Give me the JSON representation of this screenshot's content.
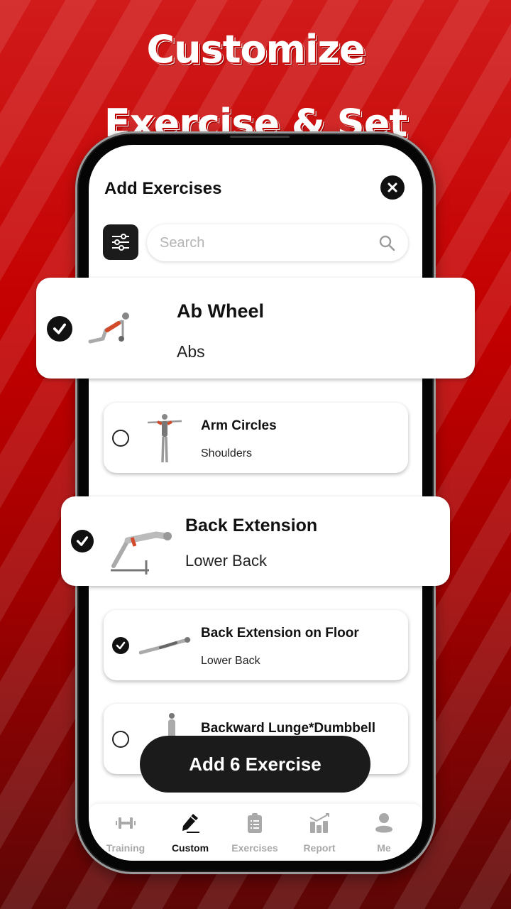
{
  "promo": {
    "line1": "Customize",
    "line2": "Exercise & Set"
  },
  "sheet": {
    "title": "Add Exercises",
    "close_icon": "close-icon",
    "filter_icon": "sliders-icon"
  },
  "search": {
    "placeholder": "Search",
    "value": "",
    "icon": "search-icon"
  },
  "exercises": [
    {
      "name": "Ab Wheel",
      "muscle": "Abs",
      "selected": true,
      "highlighted": true
    },
    {
      "name": "Arm Circles",
      "muscle": "Shoulders",
      "selected": false,
      "highlighted": false
    },
    {
      "name": "Back Extension",
      "muscle": "Lower Back",
      "selected": true,
      "highlighted": true
    },
    {
      "name": "Back Extension on Floor",
      "muscle": "Lower Back",
      "selected": true,
      "highlighted": false
    },
    {
      "name": "Backward Lunge*Dumbbell",
      "muscle": "",
      "selected": false,
      "highlighted": false
    }
  ],
  "add_button": {
    "label": "Add 6 Exercise"
  },
  "tabbar": {
    "active": "Custom",
    "tabs": [
      {
        "label": "Training",
        "icon": "dumbbell-icon"
      },
      {
        "label": "Custom",
        "icon": "pencil-icon"
      },
      {
        "label": "Exercises",
        "icon": "clipboard-list-icon"
      },
      {
        "label": "Report",
        "icon": "bar-chart-icon"
      },
      {
        "label": "Me",
        "icon": "user-icon"
      }
    ]
  },
  "colors": {
    "accent": "#c40000",
    "dark": "#1b1b1b",
    "inactive_tab": "#a9a9a9"
  }
}
